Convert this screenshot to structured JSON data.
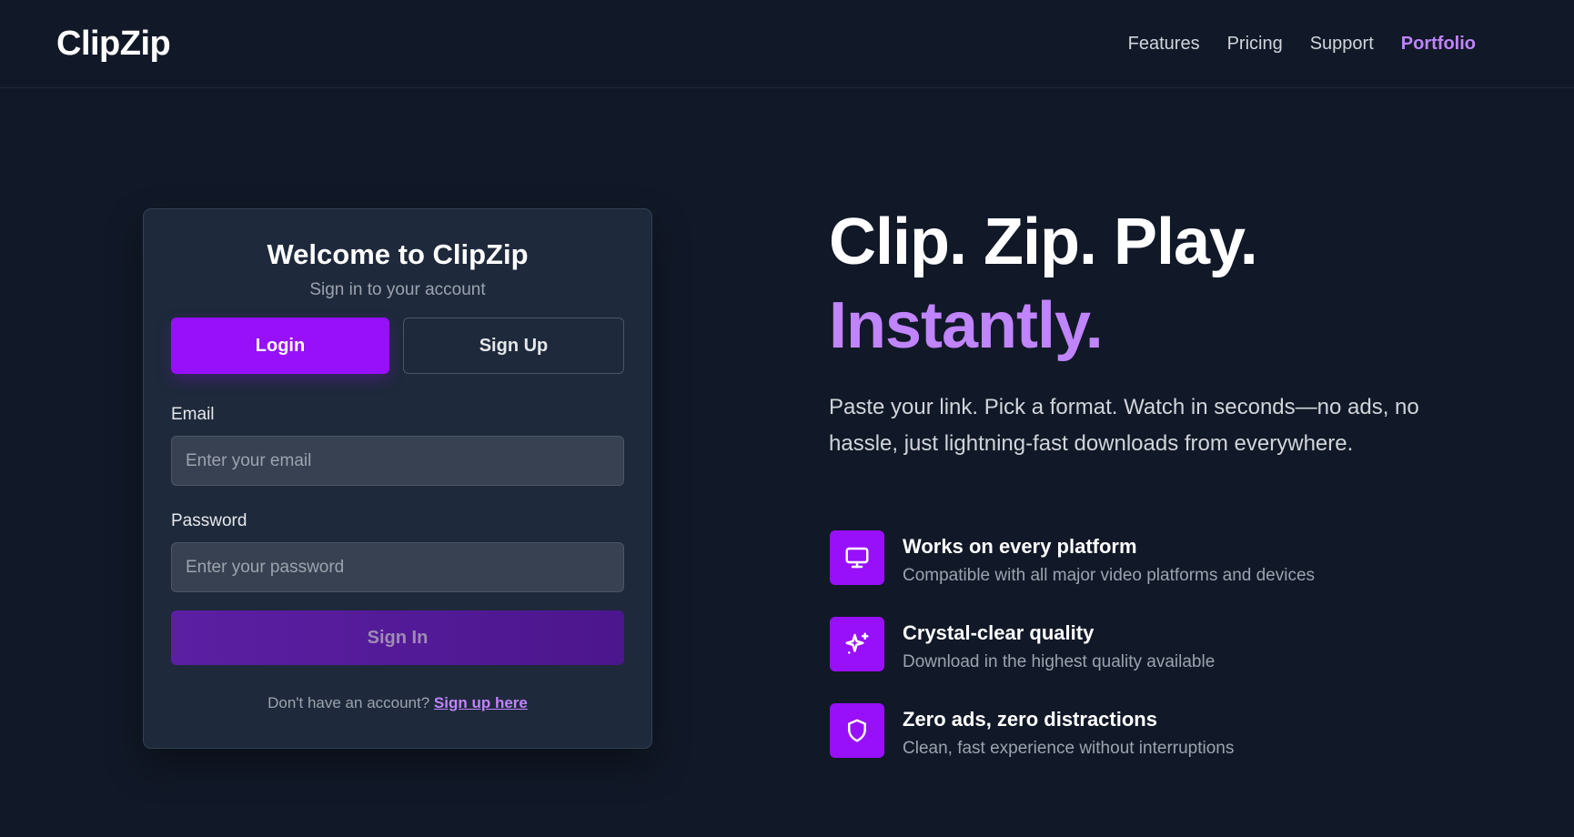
{
  "header": {
    "logo": "ClipZip",
    "nav": [
      {
        "label": "Features"
      },
      {
        "label": "Pricing"
      },
      {
        "label": "Support"
      },
      {
        "label": "Portfolio",
        "active": true
      }
    ]
  },
  "login_card": {
    "title": "Welcome to ClipZip",
    "subtitle": "Sign in to your account",
    "tabs": {
      "login": "Login",
      "signup": "Sign Up"
    },
    "email": {
      "label": "Email",
      "placeholder": "Enter your email",
      "value": ""
    },
    "password": {
      "label": "Password",
      "placeholder": "Enter your password",
      "value": ""
    },
    "submit_label": "Sign In",
    "footer_text": "Don't have an account?",
    "footer_link": "Sign up here"
  },
  "hero": {
    "line1": "Clip. Zip. Play.",
    "line2": "Instantly.",
    "description": "Paste your link. Pick a format. Watch in seconds—no ads, no hassle, just lightning-fast downloads from everywhere."
  },
  "features": [
    {
      "icon": "monitor-icon",
      "title": "Works on every platform",
      "description": "Compatible with all major video platforms and devices"
    },
    {
      "icon": "sparkles-icon",
      "title": "Crystal-clear quality",
      "description": "Download in the highest quality available"
    },
    {
      "icon": "shield-icon",
      "title": "Zero ads, zero distractions",
      "description": "Clean, fast experience without interruptions"
    }
  ],
  "colors": {
    "background": "#111827",
    "card": "#1e293b",
    "accent": "#9810fa",
    "accent_text": "#c084fc"
  }
}
